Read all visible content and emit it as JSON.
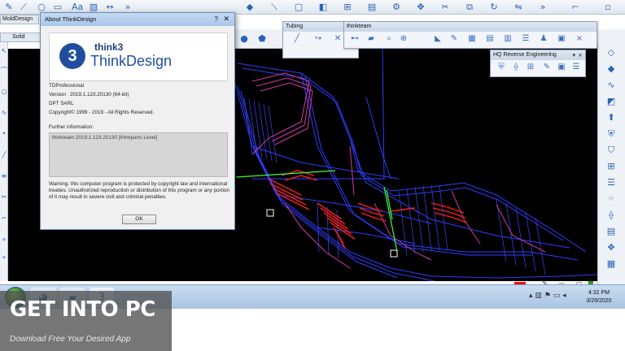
{
  "top_toolbar": {
    "buttons": [
      "pencil-icon",
      "curve-icon",
      "circle-icon",
      "rectangle-icon",
      "text-tool-icon",
      "hatch-icon",
      "dimension-icon",
      "more-icon"
    ],
    "text_tool_label": "Aa"
  },
  "left_panels": {
    "moldesign_tab": "MoldDesign",
    "solid_label": "Solid"
  },
  "tubing_panel": {
    "title": "Tubing",
    "icons": [
      "pipe-icon",
      "pipe-bend-icon",
      "wrench-icon"
    ]
  },
  "thinkteam_panel": {
    "title": "thinkteam",
    "icons": [
      "link-icon",
      "folder-icon",
      "search-icon",
      "zoom-icon",
      "tag-icon",
      "edit-icon",
      "table-icon",
      "grid-icon"
    ]
  },
  "hq_panel": {
    "title": "HQ Reverse Engineering",
    "icons": [
      "shield-icon",
      "scan-icon",
      "mesh-icon",
      "edit-mesh-icon",
      "image-icon",
      "layers-icon"
    ]
  },
  "about_dialog": {
    "title": "About ThinkDesign",
    "help_label": "?",
    "logo_circle": "3",
    "logo_brand": "think3",
    "logo_product": "ThinkDesign",
    "edition": "TDProfessional",
    "version_label": "Version",
    "version_value": "2019.1.123.20130 (64-bit)",
    "company": "DPT SARL",
    "copyright": "Copyright© 1999 - 2019 - All Rights Reserved.",
    "further_info_label": "Further information:",
    "further_info_value": "thinkteam 2019.1.123.20130 [thinkparts Level]",
    "warning": "Warning: this computer program is protected by copyright law and international treaties. Unauthorized reproduction or distribution of this program or any portion of it may result in severe civil and criminal penalties.",
    "ok_label": "OK"
  },
  "taskbar": {
    "pinned": [
      "explorer-icon",
      "folder-icon",
      "thinkdesign-icon"
    ],
    "thinkdesign_glyph": "3",
    "time": "4:32 PM",
    "date": "3/29/2020"
  },
  "status": {
    "color_swatch": "#ff0000"
  },
  "watermark": {
    "title": "GET INTO PC",
    "subtitle": "Download Free Your Desired App"
  },
  "colors": {
    "viewport_bg": "#000000",
    "accent_blue": "#1f4e9e",
    "wireframe_blue": "#2f3dff",
    "wireframe_magenta": "#d13aa6",
    "wireframe_red": "#ff1e1e",
    "wireframe_green": "#3cff3c"
  }
}
